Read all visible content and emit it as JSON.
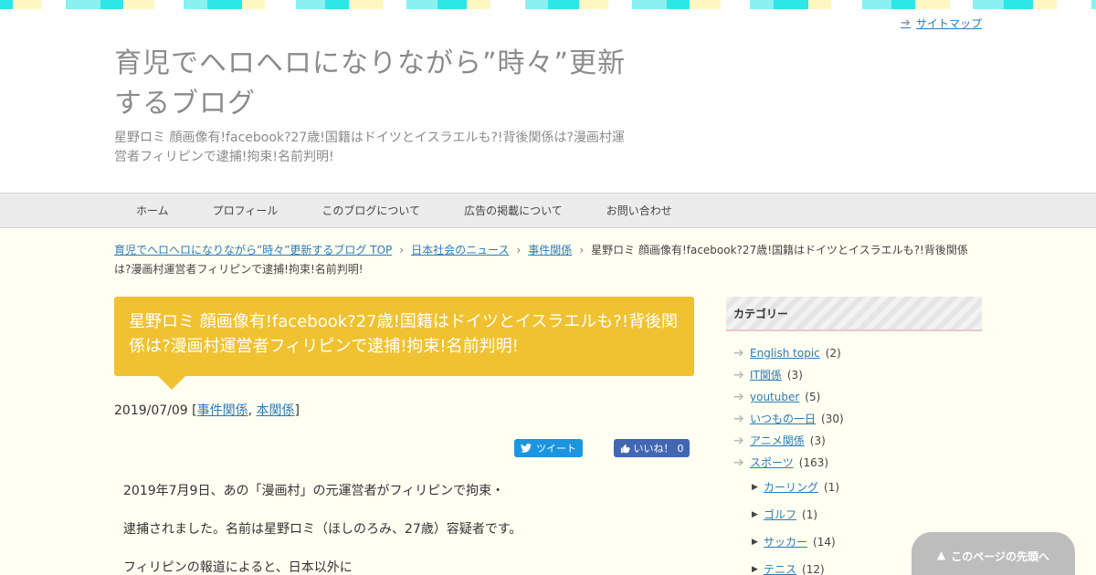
{
  "header": {
    "sitemap_label": "サイトマップ",
    "site_title": "育児でヘロヘロになりながら”時々”更新するブログ",
    "site_description": "星野ロミ 顔画像有!facebook?27歳!国籍はドイツとイスラエルも?!背後関係は?漫画村運営者フィリピンで逮捕!拘束!名前判明!"
  },
  "nav": {
    "items": [
      "ホーム",
      "プロフィール",
      "このブログについて",
      "広告の掲載について",
      "お問い合わせ"
    ]
  },
  "breadcrumb": {
    "items": [
      "育児でヘロヘロになりながら”時々”更新するブログ TOP",
      "日本社会のニュース",
      "事件関係"
    ],
    "current": "星野ロミ 顔画像有!facebook?27歳!国籍はドイツとイスラエルも?!背後関係は?漫画村運営者フィリピンで逮捕!拘束!名前判明!"
  },
  "post": {
    "title": "星野ロミ 顔画像有!facebook?27歳!国籍はドイツとイスラエルも?!背後関係は?漫画村運営者フィリピンで逮捕!拘束!名前判明!",
    "date": "2019/07/09",
    "categories": [
      "事件関係",
      "本関係"
    ],
    "body": [
      "2019年7月9日、あの「漫画村」の元運営者がフィリピンで拘束・",
      "逮捕されました。名前は星野ロミ（ほしのろみ、27歳）容疑者です。",
      "フィリピンの報道によると、日本以外に"
    ]
  },
  "share": {
    "tweet_label": "ツイート",
    "like_label": "いいね！",
    "like_count": "0"
  },
  "sidebar": {
    "widget_title": "カテゴリー",
    "categories": [
      {
        "name": "English topic",
        "count": "(2)"
      },
      {
        "name": "IT関係",
        "count": "(3)"
      },
      {
        "name": "youtuber",
        "count": "(5)"
      },
      {
        "name": "いつもの一日",
        "count": "(30)"
      },
      {
        "name": "アニメ関係",
        "count": "(3)"
      },
      {
        "name": "スポーツ",
        "count": "(163)"
      }
    ],
    "subcategories": [
      {
        "name": "カーリング",
        "count": "(1)"
      },
      {
        "name": "ゴルフ",
        "count": "(1)"
      },
      {
        "name": "サッカー",
        "count": "(14)"
      },
      {
        "name": "テニス",
        "count": "(12)"
      }
    ]
  },
  "back_to_top": "このページの先頭へ",
  "colors": {
    "accent": "#f0c232",
    "link": "#2b7bb9",
    "page_background": "#fffff2",
    "stripe": [
      "#2ee6e6",
      "#8af0f0",
      "#ffffff",
      "#fff7c2"
    ]
  }
}
